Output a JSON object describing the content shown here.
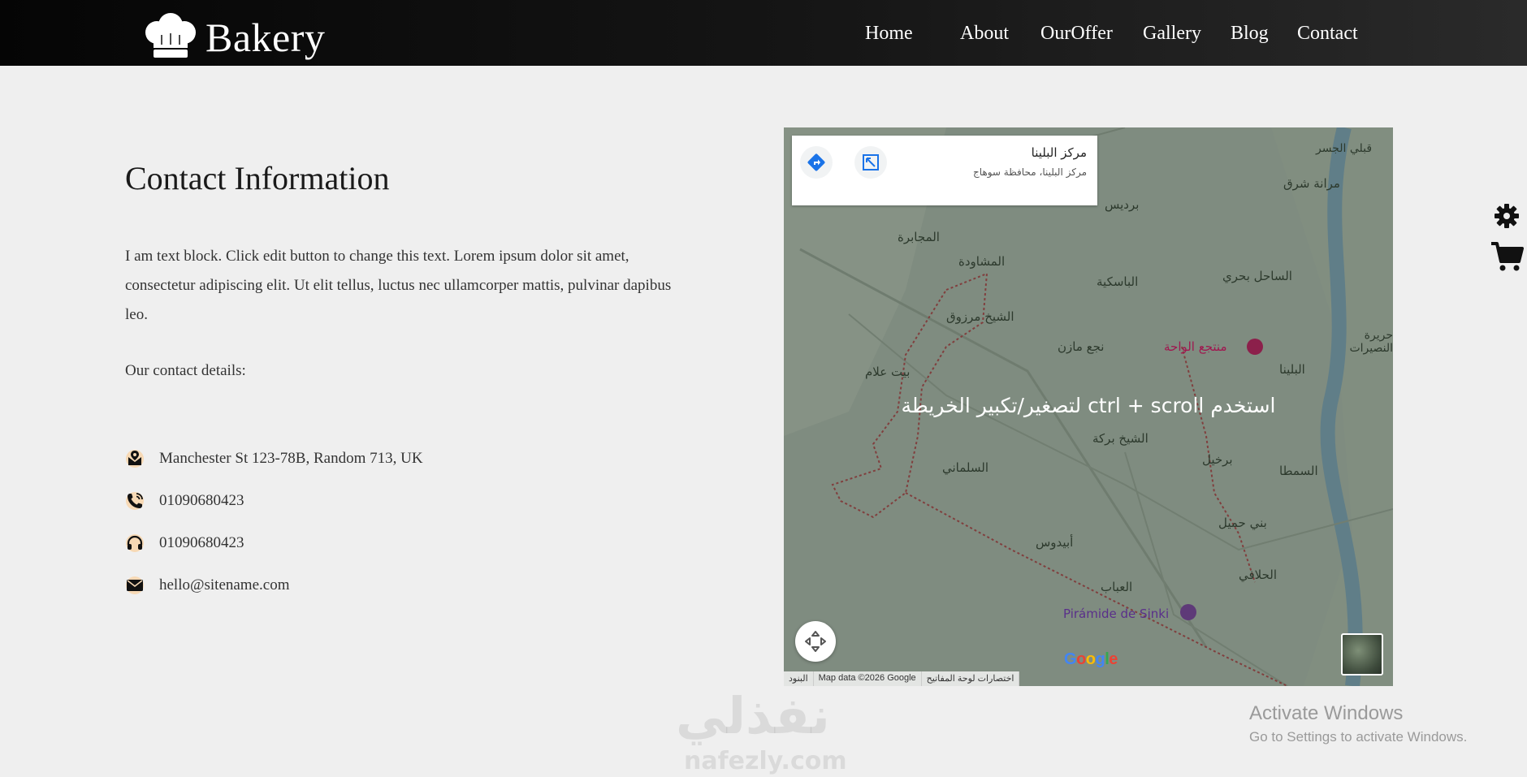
{
  "header": {
    "brand": "Bakery",
    "nav": [
      "Home",
      "About",
      "OurOffer",
      "Gallery",
      "Blog",
      "Contact"
    ]
  },
  "contact": {
    "title": "Contact Information",
    "description": "I am text block. Click edit button to change this text. Lorem ipsum dolor sit amet, consectetur adipiscing elit. Ut elit tellus, luctus nec ullamcorper mattis, pulvinar dapibus leo.",
    "details_label": "Our contact details:",
    "address": "Manchester St 123-78B, Random 713, UK",
    "phone": "01090680423",
    "support": "01090680423",
    "email": "hello@sitename.com"
  },
  "map": {
    "place_title": "مركز البلينا",
    "place_address": "مركز البلينا، محافظة سوهاج",
    "overlay_hint": "استخدم ctrl + scroll لتصغير/تكبير الخريطة",
    "logo_text": "Google",
    "footer": [
      "البنود",
      "Map data ©2026 Google",
      "اختصارات لوحة المفاتيح"
    ],
    "labels": [
      "بردیس",
      "المجابرة",
      "المشاودة",
      "الشيخ مرزوق",
      "نجع مازن",
      "الباسكية",
      "الساحل بحري",
      "مرانة شرق",
      "منتجع الواحة",
      "بيت علام",
      "الشيخ بركة",
      "البلينا",
      "برخيل",
      "السلماني",
      "أبيدوس",
      "بني حميل",
      "العباب",
      "الحلافي",
      "Pirámide de Sinki",
      "السمطا",
      "قبلي الجسر",
      "حريرة النصيرات"
    ]
  },
  "watermark": {
    "arabic": "نفذلي",
    "site": "nafezly.com"
  },
  "windows": {
    "title": "Activate Windows",
    "subtitle": "Go to Settings to activate Windows."
  },
  "colors": {
    "map_pin": "#c2185b",
    "google_blue": "#1a73e8",
    "icon_accent": "#f7d9b5"
  }
}
